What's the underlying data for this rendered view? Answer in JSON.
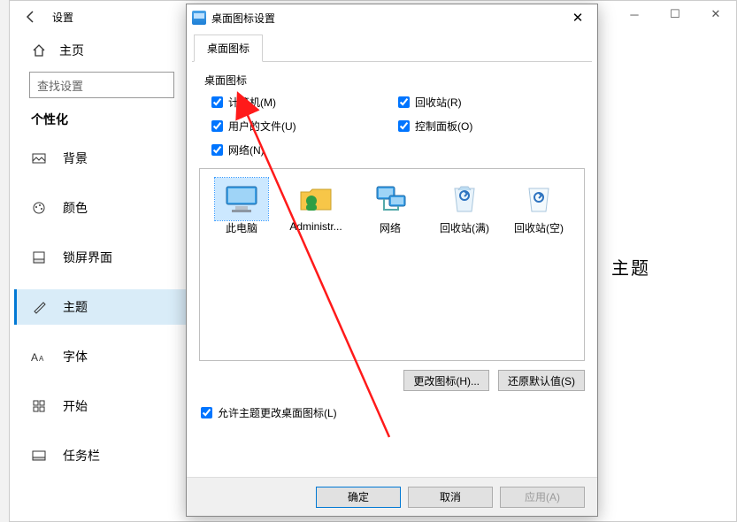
{
  "bgwin": {
    "title": "设置",
    "home": "主页",
    "searchPlaceholder": "查找设置",
    "section": "个性化",
    "nav": [
      {
        "label": "背景"
      },
      {
        "label": "颜色"
      },
      {
        "label": "锁屏界面"
      },
      {
        "label": "主题"
      },
      {
        "label": "字体"
      },
      {
        "label": "开始"
      },
      {
        "label": "任务栏"
      }
    ],
    "contentHint": "主题"
  },
  "dialog": {
    "title": "桌面图标设置",
    "tab": "桌面图标",
    "groupLabel": "桌面图标",
    "checks": [
      {
        "label": "计算机(M)",
        "checked": true
      },
      {
        "label": "回收站(R)",
        "checked": true
      },
      {
        "label": "用户的文件(U)",
        "checked": true
      },
      {
        "label": "控制面板(O)",
        "checked": true
      },
      {
        "label": "网络(N)",
        "checked": true
      }
    ],
    "icons": [
      {
        "label": "此电脑",
        "kind": "computer",
        "selected": true
      },
      {
        "label": "Administr...",
        "kind": "userfolder",
        "selected": false
      },
      {
        "label": "网络",
        "kind": "network",
        "selected": false
      },
      {
        "label": "回收站(满)",
        "kind": "recycle-full",
        "selected": false
      },
      {
        "label": "回收站(空)",
        "kind": "recycle-empty",
        "selected": false
      }
    ],
    "btnChange": "更改图标(H)...",
    "btnRestore": "还原默认值(S)",
    "allowTheme": "允许主题更改桌面图标(L)",
    "ok": "确定",
    "cancel": "取消",
    "apply": "应用(A)"
  }
}
